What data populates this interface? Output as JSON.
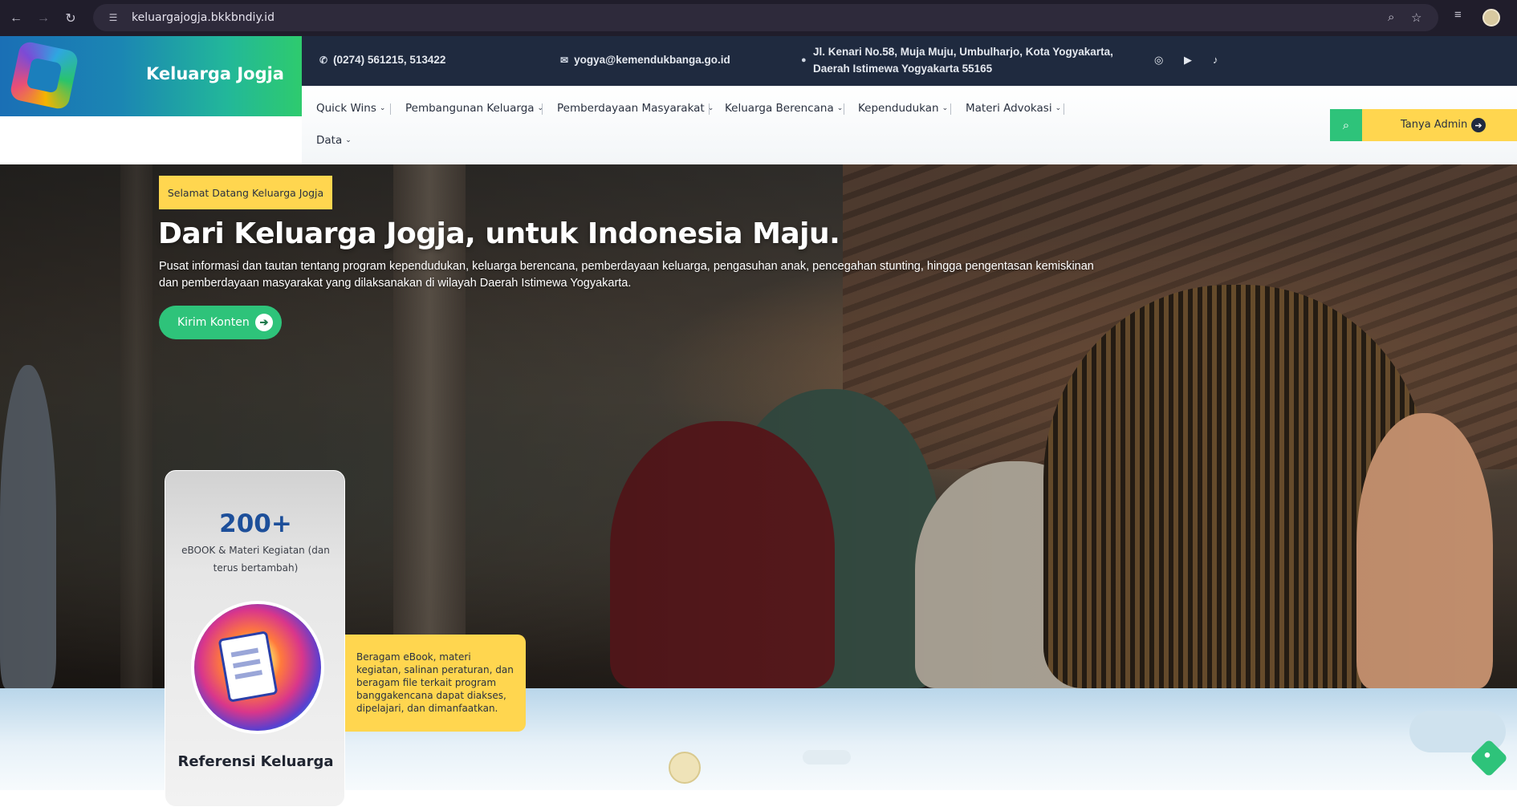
{
  "browser": {
    "url": "keluargajogja.bkkbndiy.id",
    "back_icon": "arrow-left-icon",
    "forward_icon": "arrow-right-icon",
    "reload_icon": "reload-icon"
  },
  "header": {
    "site_title": "Keluarga Jogja",
    "phone": "(0274) 561215, 513422",
    "email": "yogya@kemendukbanga.go.id",
    "address": "Jl. Kenari No.58, Muja Muju, Umbulharjo, Kota Yogyakarta, Daerah Istimewa Yogyakarta 55165"
  },
  "nav": {
    "items": [
      {
        "label": "Quick Wins"
      },
      {
        "label": "Pembangunan Keluarga"
      },
      {
        "label": "Pemberdayaan Masyarakat"
      },
      {
        "label": "Keluarga Berencana"
      },
      {
        "label": "Kependudukan"
      },
      {
        "label": "Materi Advokasi"
      },
      {
        "label": "Data"
      }
    ],
    "ask_label": "Tanya Admin"
  },
  "hero": {
    "badge": "Selamat Datang Keluarga Jogja",
    "headline": "Dari Keluarga Jogja, untuk Indonesia Maju.",
    "description": "Pusat informasi dan tautan tentang program kependudukan, keluarga berencana, pemberdayaan keluarga, pengasuhan anak, pencegahan stunting, hingga pengentasan kemiskinan dan pemberdayaan masyarakat yang dilaksanakan di wilayah Daerah Istimewa Yogyakarta.",
    "cta_label": "Kirim Konten"
  },
  "card": {
    "count": "200+",
    "subtitle": "eBOOK & Materi Kegiatan (dan terus bertambah)",
    "title": "Referensi Keluarga",
    "note": "Beragam eBook, materi kegiatan, salinan peraturan, dan beragam file terkait program banggakencana dapat diakses, dipelajari, dan dimanfaatkan."
  },
  "colors": {
    "accent_green": "#2ec37a",
    "accent_yellow": "#ffd64f",
    "topbar_navy": "#1f2a3f",
    "count_blue": "#1d4f9a"
  }
}
